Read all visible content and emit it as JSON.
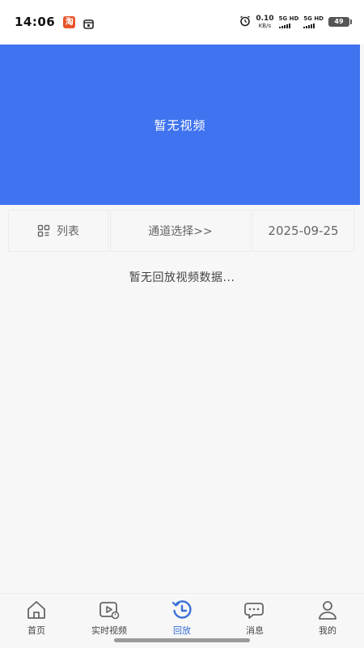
{
  "status_bar": {
    "time": "14:06",
    "app_badge": "淘",
    "net_speed_value": "0.10",
    "net_speed_unit": "KB/s",
    "sim1_label": "5G HD",
    "sim2_label": "5G HD",
    "battery": "49"
  },
  "video": {
    "empty_text": "暂无视频"
  },
  "controls": {
    "list_label": "列表",
    "channel_label": "通道选择>>",
    "date": "2025-09-25"
  },
  "playback": {
    "empty_text": "暂无回放视频数据..."
  },
  "bottom_nav": {
    "items": [
      {
        "label": "首页",
        "icon": "home-icon"
      },
      {
        "label": "实时视频",
        "icon": "live-video-icon"
      },
      {
        "label": "回放",
        "icon": "playback-icon",
        "active": true
      },
      {
        "label": "消息",
        "icon": "message-icon"
      },
      {
        "label": "我的",
        "icon": "profile-icon"
      }
    ]
  },
  "colors": {
    "primary": "#3f73f0",
    "active_tab": "#3a6fd8"
  }
}
